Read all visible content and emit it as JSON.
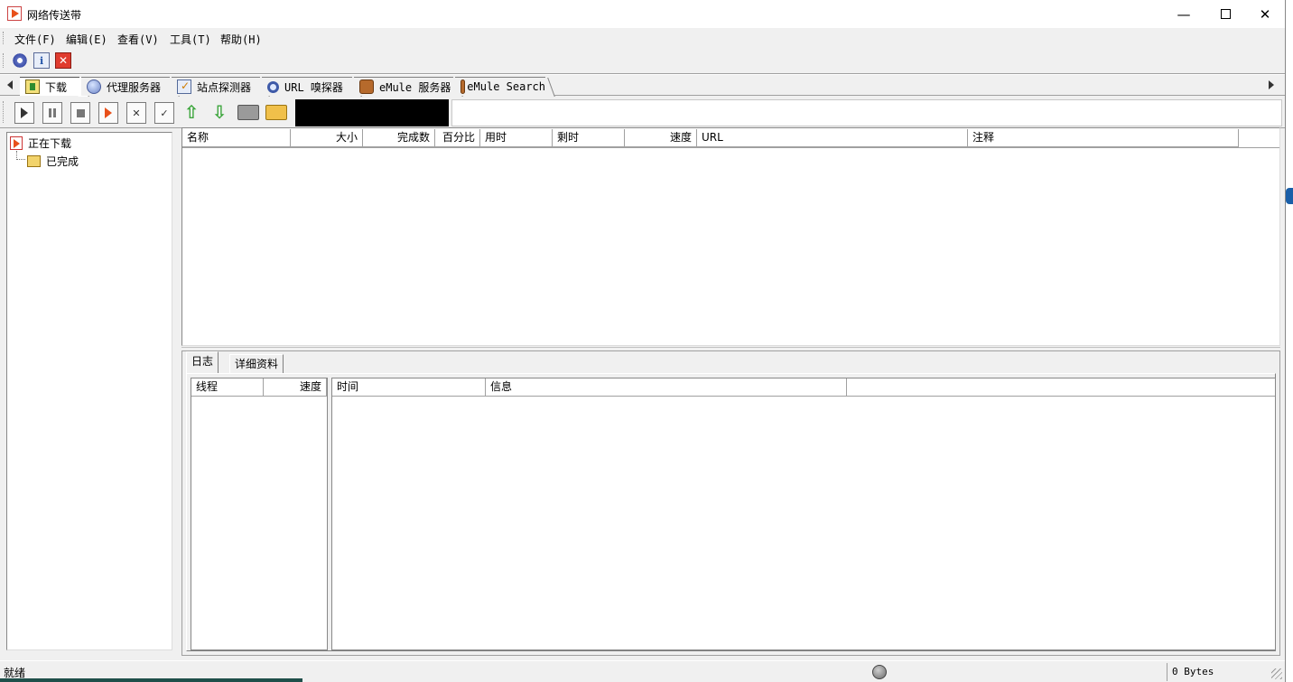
{
  "window": {
    "title": "网络传送带",
    "controls": {
      "minimize": "—",
      "close": "✕"
    }
  },
  "menu": {
    "items": [
      "文件(F)",
      "编辑(E)",
      "查看(V)",
      "工具(T)",
      "帮助(H)"
    ]
  },
  "quick_toolbar": {
    "buttons": [
      "gear-icon",
      "info-icon",
      "close-red-icon"
    ],
    "close_glyph": "✕",
    "info_glyph": "i"
  },
  "main_tabs": [
    {
      "label": "下载",
      "icon": "download-icon",
      "active": true
    },
    {
      "label": "代理服务器",
      "icon": "proxy-icon",
      "active": false
    },
    {
      "label": "站点探测器",
      "icon": "site-scan-icon",
      "active": false
    },
    {
      "label": "URL 嗅探器",
      "icon": "sniffer-icon",
      "active": false
    },
    {
      "label": "eMule 服务器",
      "icon": "emule-icon",
      "active": false
    },
    {
      "label": "eMule Search",
      "icon": "emule-icon",
      "active": false
    }
  ],
  "action_toolbar": {
    "buttons": [
      "start-icon",
      "pause-icon",
      "stop-icon",
      "schedule-icon",
      "delete-icon",
      "check-icon",
      "move-up-icon",
      "move-down-icon",
      "open-folder-icon",
      "folder-icon"
    ],
    "up_glyph": "⇧",
    "down_glyph": "⇩",
    "delete_glyph": "✕",
    "check_glyph": "✓",
    "url_value": ""
  },
  "tree": {
    "items": [
      {
        "label": "正在下载",
        "icon": "downloading-icon"
      },
      {
        "label": "已完成",
        "icon": "completed-folder-icon"
      }
    ]
  },
  "download_list": {
    "columns": [
      "名称",
      "大小",
      "完成数",
      "百分比",
      "用时",
      "剩时",
      "速度",
      "URL",
      "注释"
    ],
    "rows": []
  },
  "detail_tabs": {
    "log": "日志",
    "details": "详细资料"
  },
  "thread_list": {
    "columns": [
      "线程",
      "速度"
    ]
  },
  "log_list": {
    "columns": [
      "时间",
      "信息",
      ""
    ]
  },
  "status": {
    "text": "就绪",
    "bytes": "0 Bytes"
  },
  "colors": {
    "accent": "#e8501a",
    "window_bg": "#f0f0f0",
    "list_bg": "#ffffff",
    "border": "#a0a0a0"
  }
}
